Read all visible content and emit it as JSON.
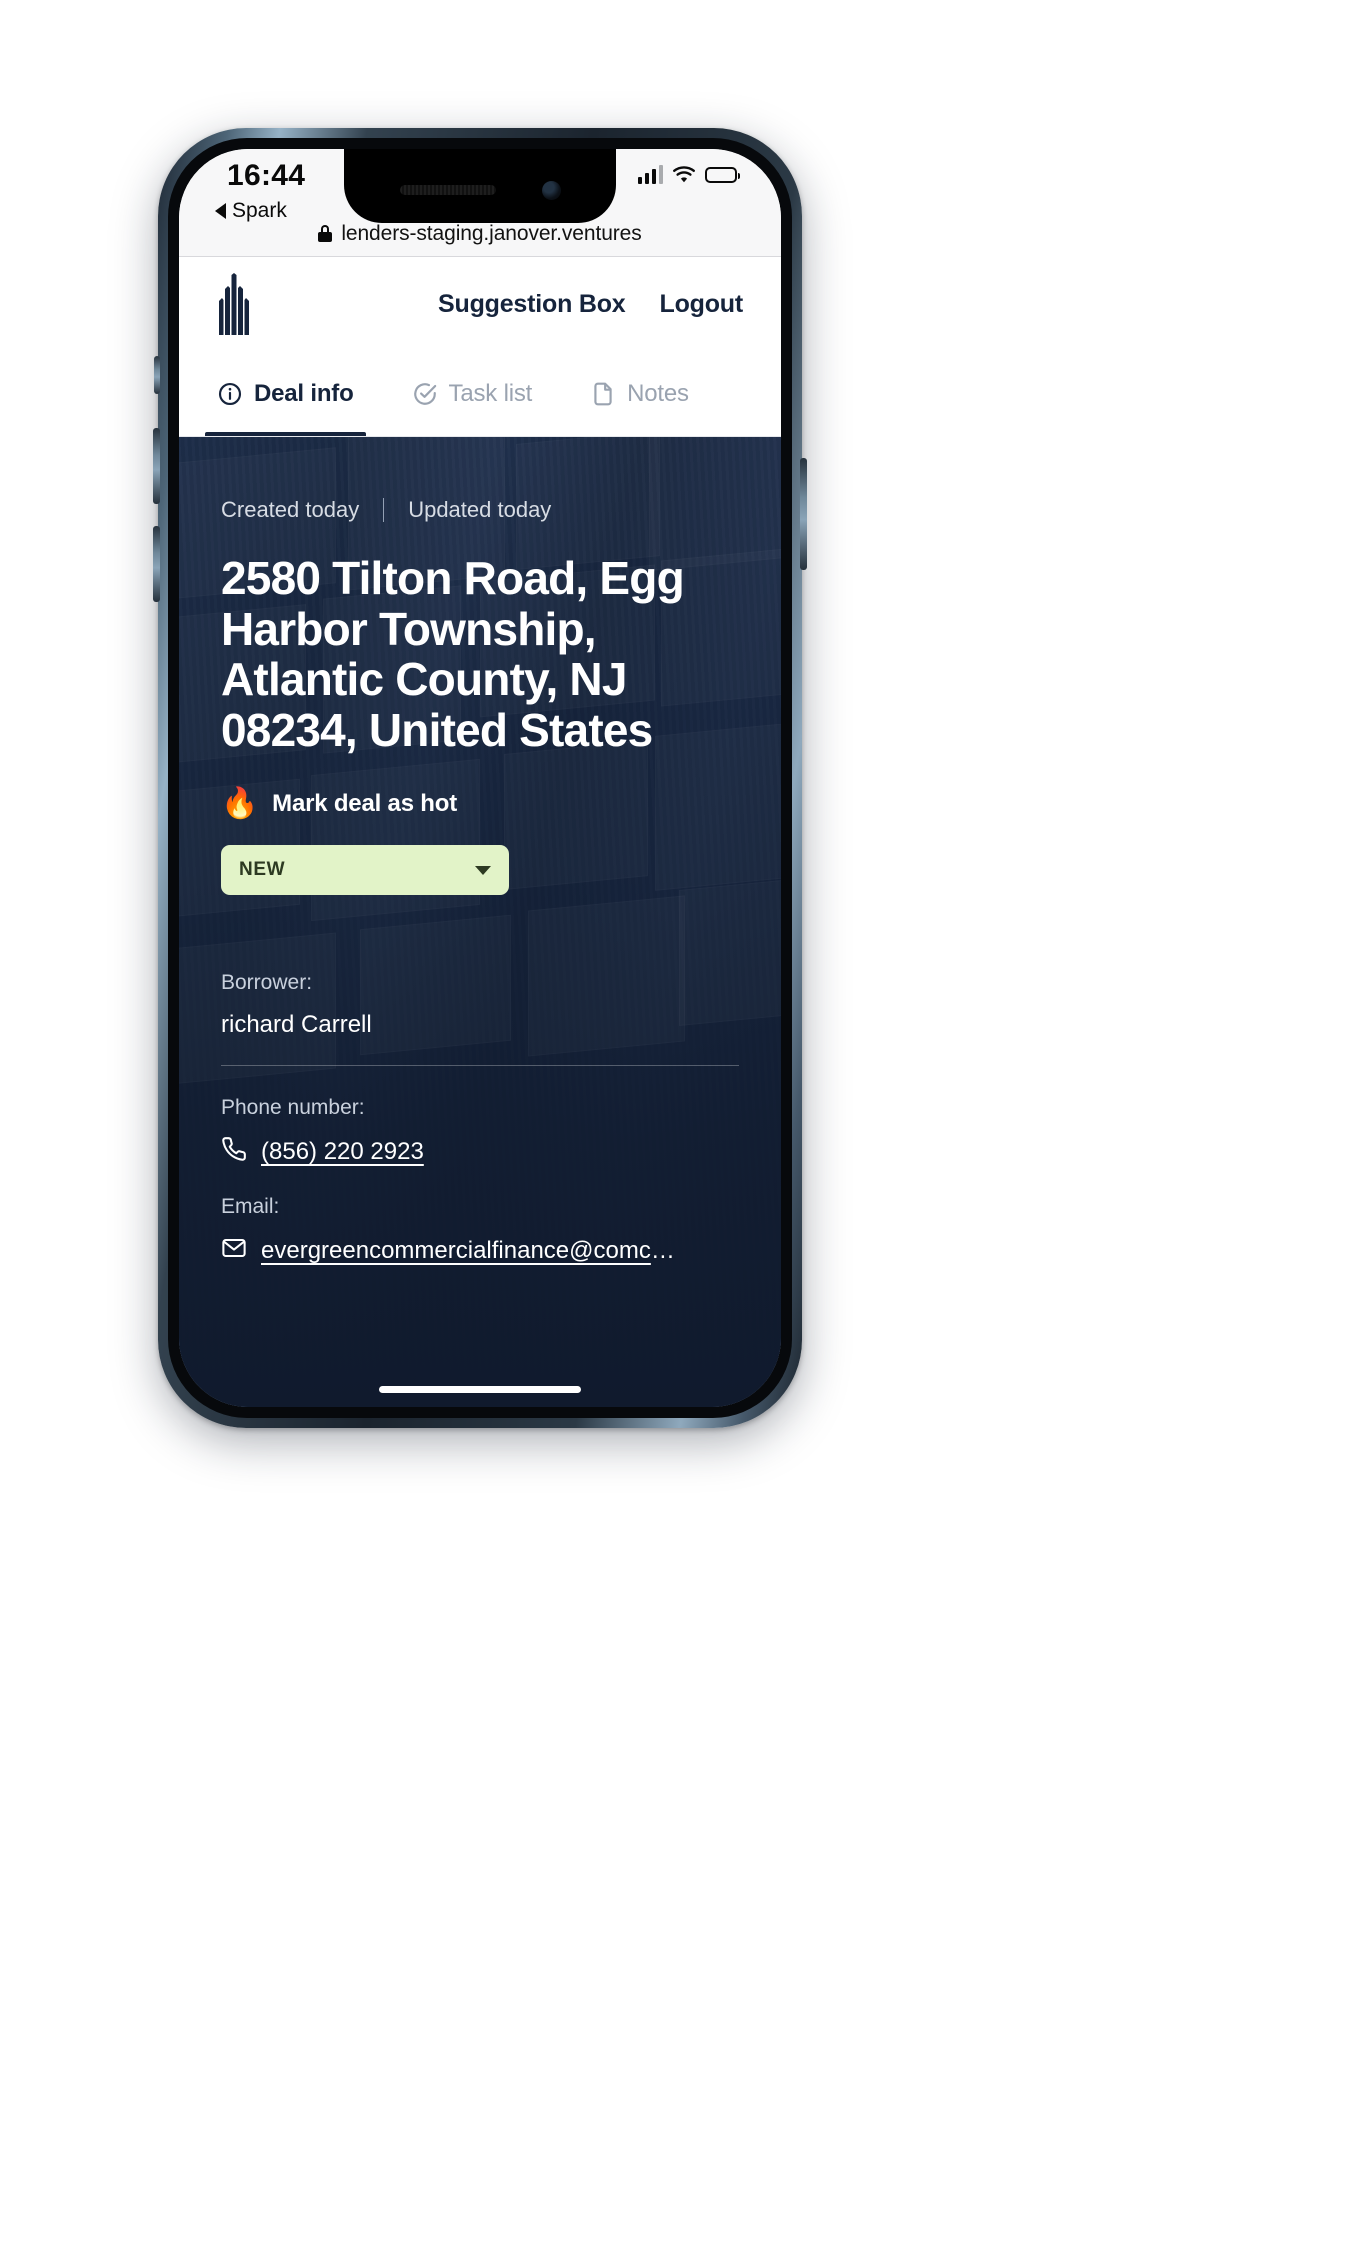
{
  "status_bar": {
    "time": "16:44",
    "back_label": "Spark",
    "back_icon": "caret-left-icon",
    "signal_icon": "cellular-signal-icon",
    "wifi_icon": "wifi-icon",
    "battery_icon": "battery-icon"
  },
  "browser": {
    "lock_icon": "lock-icon",
    "url": "lenders-staging.janover.ventures"
  },
  "app_header": {
    "logo_icon": "janover-building-logo",
    "nav": [
      {
        "label": "Suggestion Box",
        "name": "suggestion-box-link"
      },
      {
        "label": "Logout",
        "name": "logout-link"
      }
    ]
  },
  "tabs": [
    {
      "label": "Deal info",
      "icon": "info-circle-icon",
      "active": true
    },
    {
      "label": "Task list",
      "icon": "check-circle-icon",
      "active": false
    },
    {
      "label": "Notes",
      "icon": "document-icon",
      "active": false
    }
  ],
  "deal": {
    "created": "Created today",
    "updated": "Updated today",
    "title": "2580 Tilton Road, Egg Harbor Township, Atlantic County, NJ 08234, United States",
    "mark_hot_label": "Mark deal as hot",
    "flame_icon": "flame-icon",
    "status_value": "NEW",
    "status_chevron_icon": "chevron-down-icon",
    "borrower_label": "Borrower:",
    "borrower_value": "richard Carrell",
    "phone_label": "Phone number:",
    "phone_icon": "phone-icon",
    "phone_value": "(856) 220 2923",
    "email_label": "Email:",
    "email_icon": "envelope-icon",
    "email_value": "evergreencommercialfinance@comcast.n…"
  },
  "colors": {
    "brand_navy": "#16243c",
    "status_chip_bg": "#e2f3c8",
    "tab_inactive": "#9aa3b0"
  }
}
